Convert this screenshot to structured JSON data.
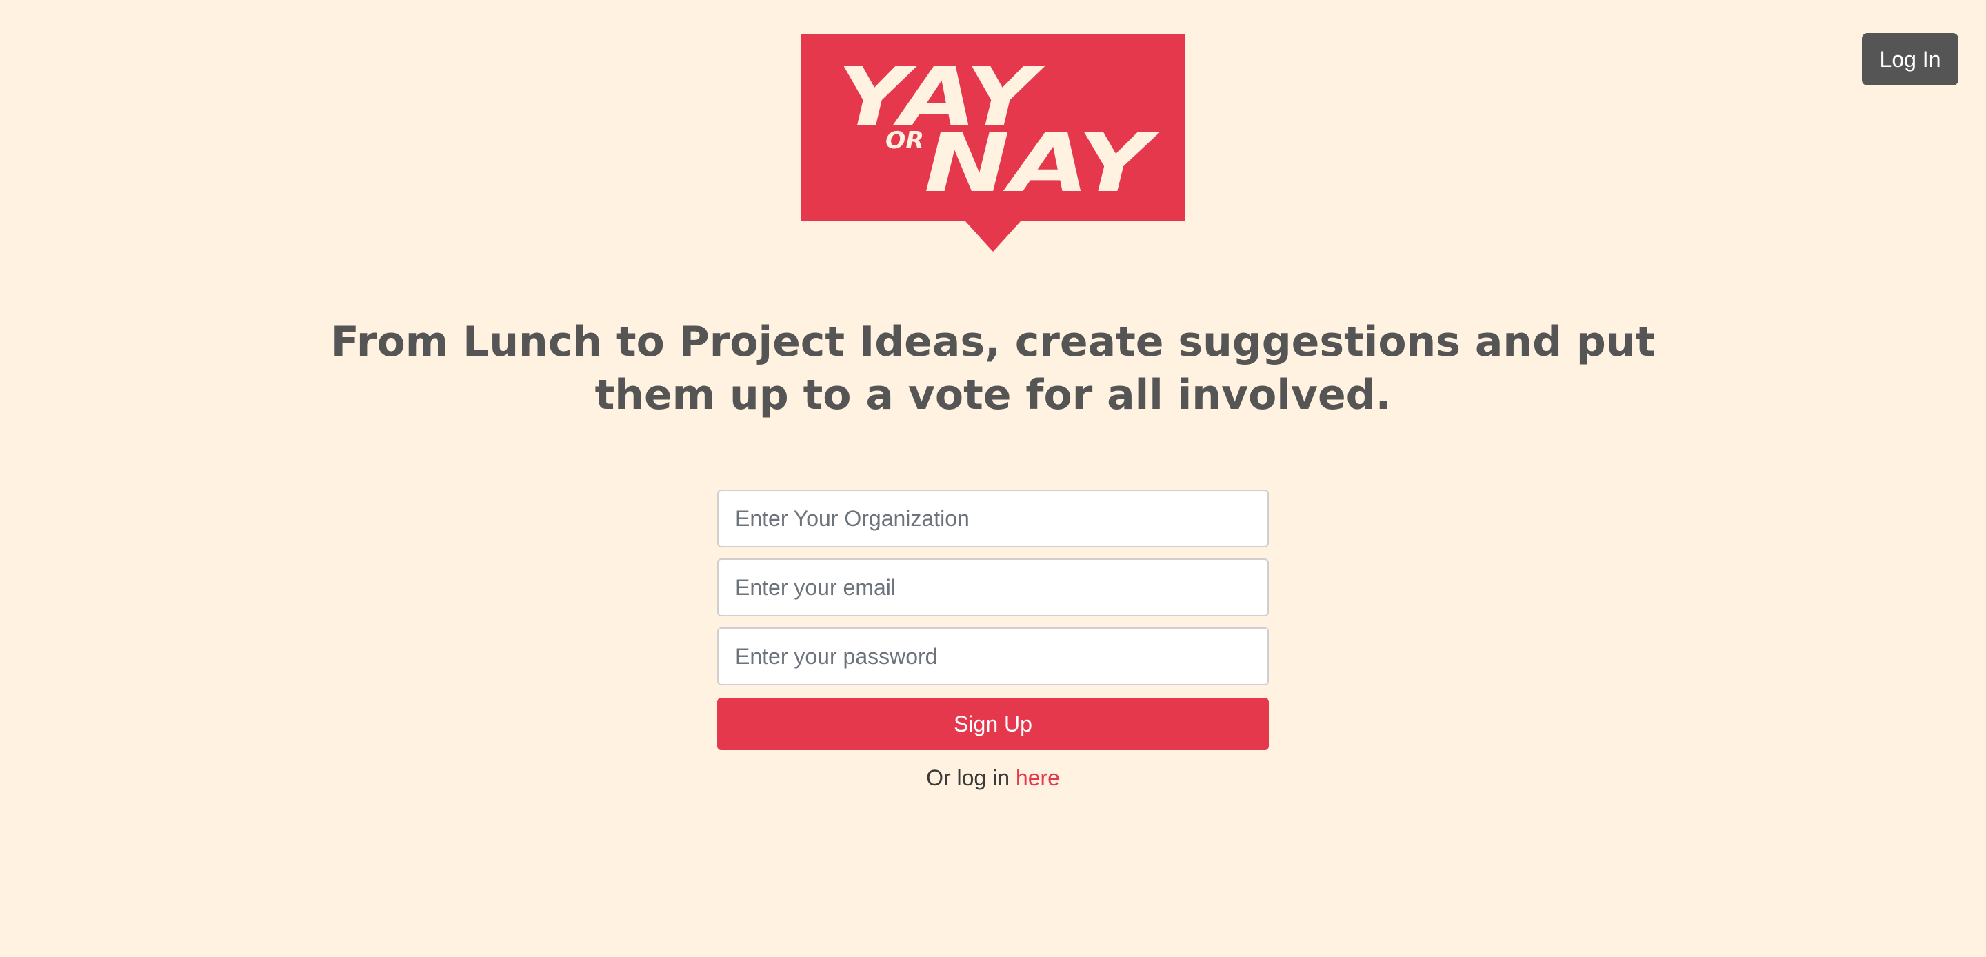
{
  "header": {
    "login_button_label": "Log In"
  },
  "logo": {
    "line_top": "YAY",
    "connector": "OR",
    "line_bottom": "NAY",
    "brand_color": "#e5384d",
    "text_color": "#fff2e0"
  },
  "hero": {
    "headline": "From Lunch to Project Ideas, create suggestions and put them up to a vote for all involved."
  },
  "signup_form": {
    "organization_placeholder": "Enter Your Organization",
    "organization_value": "",
    "email_placeholder": "Enter your email",
    "email_value": "",
    "password_placeholder": "Enter your password",
    "password_value": "",
    "submit_label": "Sign Up",
    "alt_prefix": "Or log in",
    "alt_link": "here"
  },
  "colors": {
    "background": "#fff2e0",
    "accent": "#e5384d",
    "heading": "#555555",
    "dark_button": "#555555"
  }
}
